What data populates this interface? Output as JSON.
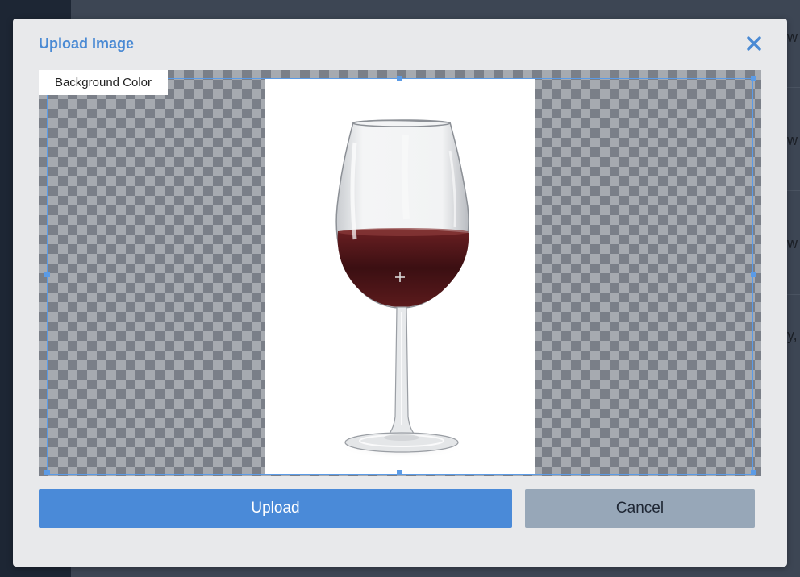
{
  "modal": {
    "title": "Upload Image",
    "close_icon": "close-icon"
  },
  "editor": {
    "background_color_label": "Background Color",
    "crosshair_icon": "move-crosshair-icon",
    "image_subject": "wine-glass-image"
  },
  "actions": {
    "upload_label": "Upload",
    "cancel_label": "Cancel"
  },
  "backdrop": {
    "peek_text": [
      "w",
      "w",
      "w",
      "y,"
    ]
  },
  "colors": {
    "accent": "#4a8ad4",
    "crop_border": "#5b9be6",
    "upload_button": "#4a8ad8",
    "cancel_button": "#97a7b8",
    "modal_bg": "#e8e9eb",
    "wine": "#4a1418"
  }
}
